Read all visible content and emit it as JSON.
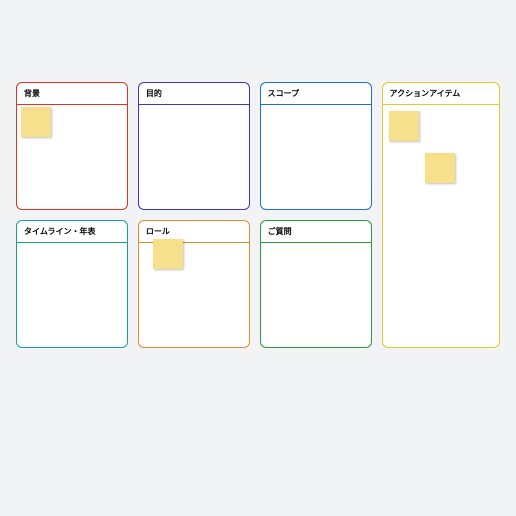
{
  "panels": {
    "background": {
      "title": "背景",
      "color": "red",
      "stickies": [
        {
          "x": 4,
          "y": 2
        }
      ]
    },
    "purpose": {
      "title": "目的",
      "color": "purple",
      "stickies": []
    },
    "scope": {
      "title": "スコープ",
      "color": "blue",
      "stickies": []
    },
    "timeline": {
      "title": "タイムライン・年表",
      "color": "teal",
      "stickies": []
    },
    "roles": {
      "title": "ロール",
      "color": "orange",
      "stickies": [
        {
          "x": 14,
          "y": -4
        }
      ]
    },
    "questions": {
      "title": "ご質問",
      "color": "green",
      "stickies": []
    },
    "action_items": {
      "title": "アクションアイテム",
      "color": "yellow",
      "stickies": [
        {
          "x": 6,
          "y": 6
        },
        {
          "x": 42,
          "y": 48
        }
      ]
    }
  }
}
